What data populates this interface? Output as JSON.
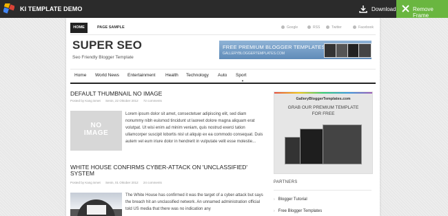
{
  "topbar": {
    "brand": "KI TEMPLATE DEMO",
    "download_label": "Download",
    "remove_label": "Remove Frame",
    "colors": {
      "bar": "#2b2b2b",
      "remove": "#6ab640"
    }
  },
  "site": {
    "topnav": {
      "home": "HOME",
      "sample": "PAGE SAMPLE"
    },
    "social": [
      "Google",
      "RSS",
      "Twitter",
      "Facebook"
    ],
    "title": "SUPER SEO",
    "description": "Seo Friendly Blogger Template",
    "banner": {
      "line1": "FREE PREMIUM BLOGGER TEMPLATES",
      "line2": "GALLERYBLOGGERTEMPLATES.COM"
    },
    "menu": [
      "Home",
      "World News",
      "Entertainment",
      "Health",
      "Technology",
      "Auto",
      "Sport"
    ]
  },
  "posts": [
    {
      "title": "DEFAULT THUMBNAIL NO IMAGE",
      "author": "Posted by Kang ismet",
      "date": "Senin, 22 Oktober 2012",
      "comments": "72 comments",
      "thumb_text": [
        "NO",
        "IMAGE"
      ],
      "excerpt": "Lorem ipsum dolor sit amet, consectetuer adipiscing elit, sed diam nonummy nibh euismod tincidunt ut laoreet dolore magna aliquam erat volutpat. Ut wisi enim ad minim veniam, quis nostrud exerci tation ullamcorper suscipit lobortis nisl ut aliquip ex ea commodo consequat. Duis autem vel eum iriure dolor in hendrerit in vulputate velit esse molestie..."
    },
    {
      "title": "WHITE HOUSE CONFIRMS CYBER-ATTACK ON 'UNCLASSIFIED' SYSTEM",
      "author": "Posted by Kang ismet",
      "date": "Senin, 01 Oktober 2012",
      "comments": "24 comments",
      "excerpt": "The White House has confirmed it was the target of a cyber-attack but says the breach hit an unclassified network. An unnamed administration official told US media that there was no indication any"
    }
  ],
  "sidebar": {
    "ad": {
      "site": "GalleryBloggerTemplates.com",
      "line1": "GRAB OUR PREMIUM TEMPLATE",
      "line2": "FOR FREE"
    },
    "partners_title": "PARTNERS",
    "partners": [
      "Blogger Tutorial",
      "Free Blogger Templates"
    ]
  }
}
